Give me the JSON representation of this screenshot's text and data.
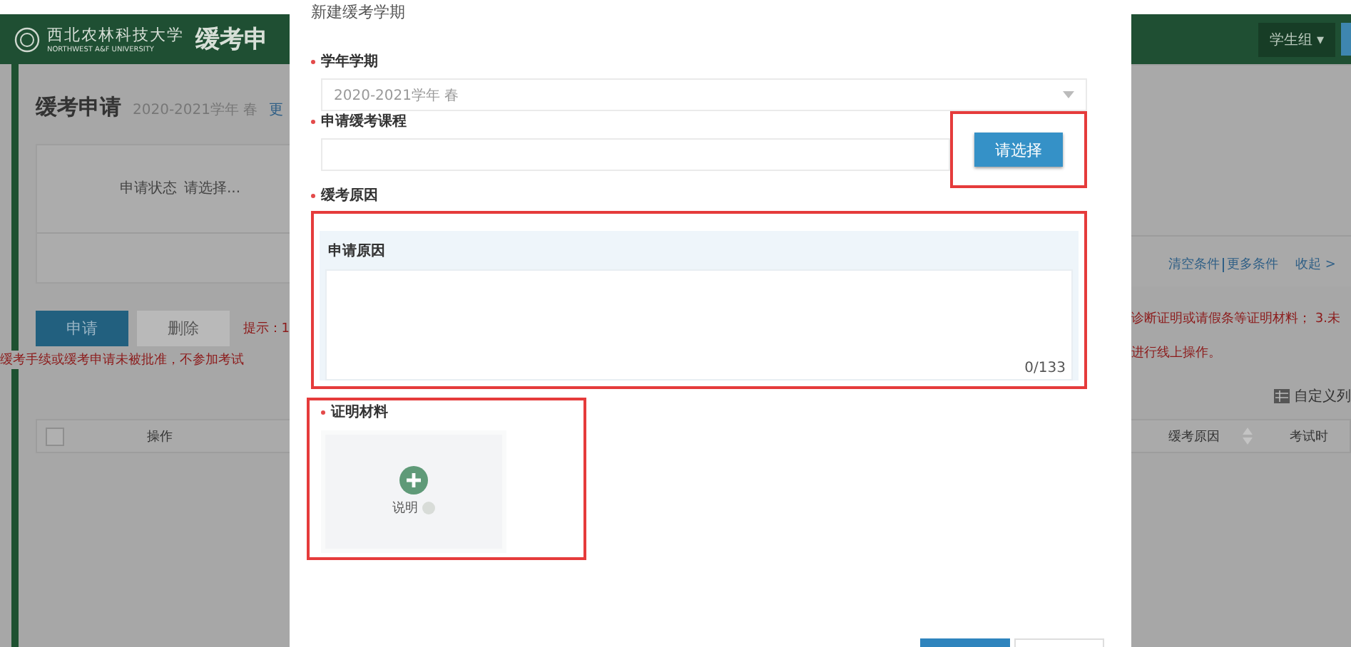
{
  "background_page": {
    "header": {
      "logo_name": "西北农林科技大学",
      "logo_subtitle": "NORTHWEST A&F UNIVERSITY",
      "page_title_partial": "缓考申",
      "user_group": "学生组",
      "user_group_caret": "▾"
    },
    "page_title": "缓考申请",
    "term": "2020-2021学年 春",
    "term_link_partial": "更",
    "filter": {
      "label": "申请状态",
      "placeholder": "请选择..."
    },
    "filter_links": [
      "清空条件",
      "更多条件",
      "收起 >"
    ],
    "toolbar_buttons": [
      {
        "label": "申请",
        "kind": "primary"
      },
      {
        "label": "删除",
        "kind": "default"
      }
    ],
    "hint_left": "提示：1",
    "notice_left": "缓考手续或缓考申请未被批准，不参加考试",
    "notice_right_1": "诊断证明或请假条等证明材料； 3.未",
    "notice_right_2": "进行线上操作。",
    "custom_columns": "自定义列",
    "select_all": {
      "checked": false
    },
    "table_left_columns": [
      "操作"
    ],
    "table_right_columns": [
      "缓考原因",
      "考试时"
    ]
  },
  "dialog": {
    "title": "新建缓考学期",
    "fields": [
      {
        "kind": "select",
        "label": "学年学期",
        "value": "2020-2021学年 春",
        "required": true,
        "highlighted": false
      },
      {
        "kind": "picker",
        "label": "申请缓考课程",
        "button": "请选择",
        "required": true,
        "highlighted": true
      },
      {
        "kind": "textarea",
        "label": "缓考原因",
        "inner_label": "申请原因",
        "counter": "0/133",
        "required": true,
        "highlighted": true
      },
      {
        "kind": "upload",
        "label": "证明材料",
        "tile_label": "说明",
        "required": true,
        "highlighted": true
      }
    ]
  }
}
